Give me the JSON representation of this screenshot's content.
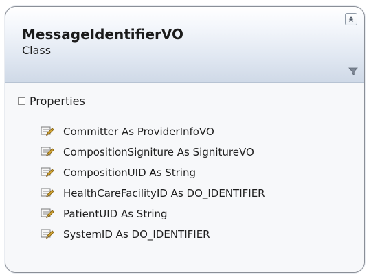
{
  "class": {
    "name": "MessageIdentifierVO",
    "kind": "Class",
    "collapse_icon": "chevron-up-icon",
    "filter_icon": "filter-icon"
  },
  "section": {
    "label": "Properties",
    "toggle_state": "expanded"
  },
  "properties": [
    {
      "label": "Committer As ProviderInfoVO",
      "icon": "property-icon"
    },
    {
      "label": "CompositionSigniture As SignitureVO",
      "icon": "property-icon"
    },
    {
      "label": "CompositionUID As String",
      "icon": "property-icon"
    },
    {
      "label": "HealthCareFacilityID As DO_IDENTIFIER",
      "icon": "property-icon"
    },
    {
      "label": "PatientUID As String",
      "icon": "property-icon"
    },
    {
      "label": "SystemID As DO_IDENTIFIER",
      "icon": "property-icon"
    }
  ],
  "colors": {
    "border": "#8a8f97",
    "header_gradient_start": "#ffffff",
    "header_gradient_end": "#cfd9e7",
    "body_background": "#f7f8fa"
  }
}
